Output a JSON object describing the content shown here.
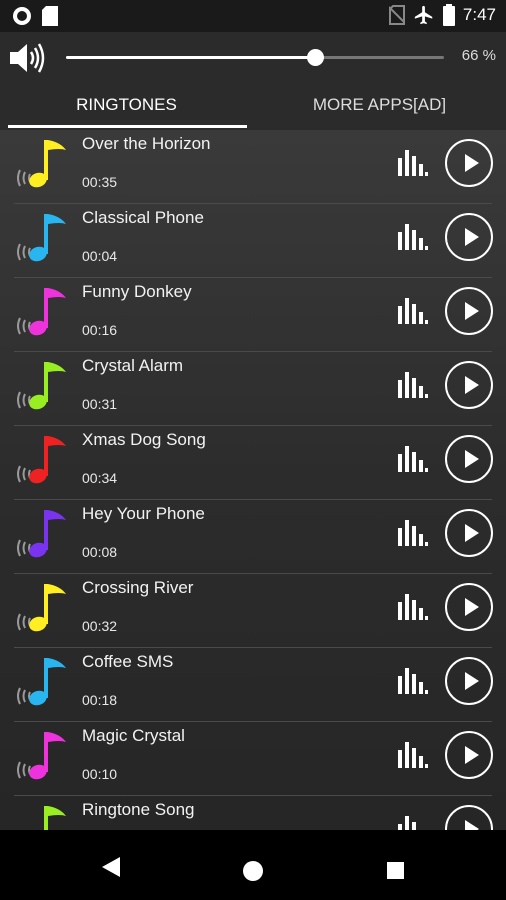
{
  "status_bar": {
    "time": "7:47",
    "left_icons": [
      "circle-record-icon",
      "sd-card-icon"
    ],
    "right_icons": [
      "no-sim-icon",
      "airplane-icon",
      "battery-icon"
    ]
  },
  "volume": {
    "icon": "speaker-icon",
    "level_percent": 66,
    "label": "66 %"
  },
  "tabs": [
    {
      "label": "RINGTONES",
      "active": true
    },
    {
      "label": "MORE APPS[AD]",
      "active": false
    }
  ],
  "ringtones": [
    {
      "title": "Over the Horizon",
      "duration": "00:35",
      "note_color": "#ffee22"
    },
    {
      "title": "Classical Phone",
      "duration": "00:04",
      "note_color": "#29b6f0"
    },
    {
      "title": "Funny Donkey",
      "duration": "00:16",
      "note_color": "#ee33dd"
    },
    {
      "title": "Crystal Alarm",
      "duration": "00:31",
      "note_color": "#99ee22"
    },
    {
      "title": "Xmas Dog Song",
      "duration": "00:34",
      "note_color": "#ee2222"
    },
    {
      "title": "Hey Your Phone",
      "duration": "00:08",
      "note_color": "#7a33ee"
    },
    {
      "title": "Crossing River",
      "duration": "00:32",
      "note_color": "#ffee22"
    },
    {
      "title": "Coffee SMS",
      "duration": "00:18",
      "note_color": "#29b6f0"
    },
    {
      "title": "Magic Crystal",
      "duration": "00:10",
      "note_color": "#ee33dd"
    },
    {
      "title": "Ringtone Song",
      "duration": "",
      "note_color": "#99ee22"
    }
  ],
  "row_icons": {
    "note": "music-note-icon",
    "wave": "sound-wave-icon",
    "equalizer": "equalizer-icon",
    "play": "play-icon"
  },
  "nav_bar": {
    "back": "back-icon",
    "home": "home-icon",
    "recents": "recents-icon"
  }
}
